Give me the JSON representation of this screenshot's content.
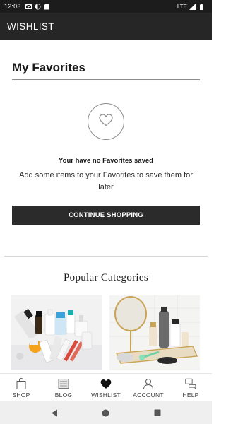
{
  "status_bar": {
    "time": "12:03",
    "network": "LTE"
  },
  "app_bar": {
    "title": "WISHLIST"
  },
  "favorites": {
    "title": "My Favorites",
    "empty_title": "Your have no Favorites saved",
    "empty_text": "Add some items to your Favorites to save them for later",
    "button_label": "CONTINUE SHOPPING"
  },
  "popular": {
    "title": "Popular Categories"
  },
  "bottom_nav": {
    "items": [
      {
        "label": "SHOP",
        "icon": "shopping-bag-icon"
      },
      {
        "label": "BLOG",
        "icon": "blog-icon"
      },
      {
        "label": "WISHLIST",
        "icon": "heart-icon",
        "active": true
      },
      {
        "label": "ACCOUNT",
        "icon": "person-icon"
      },
      {
        "label": "HELP",
        "icon": "chat-icon"
      }
    ]
  },
  "colors": {
    "app_bar": "#262626",
    "button": "#2b2b2b",
    "status_bar": "#1c1c1c"
  }
}
